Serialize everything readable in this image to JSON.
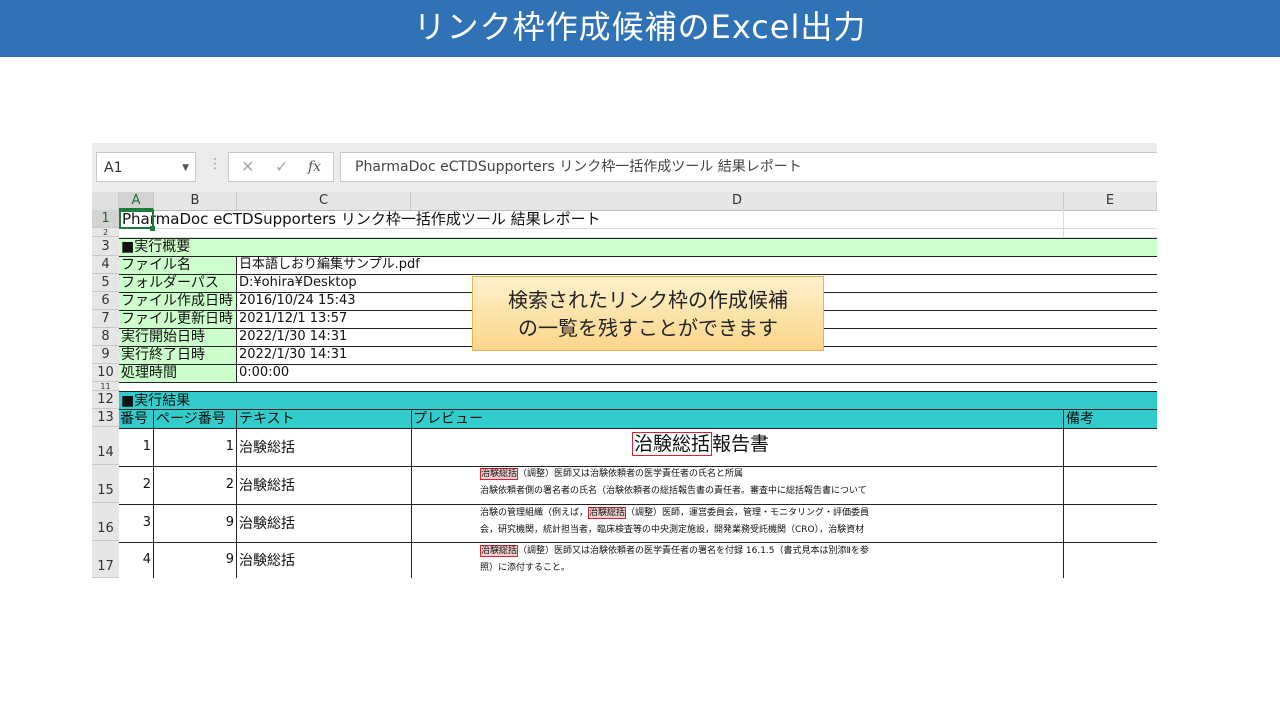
{
  "slide": {
    "title": "リンク枠作成候補のExcel出力"
  },
  "formula_bar": {
    "name_box": "A1",
    "cancel_icon": "✕",
    "enter_icon": "✓",
    "function_icon": "fx",
    "content": "PharmaDoc eCTDSupporters リンク枠一括作成ツール 結果レポート"
  },
  "columns": [
    "A",
    "B",
    "C",
    "D",
    "E"
  ],
  "rows": [
    "1",
    "2",
    "3",
    "4",
    "5",
    "6",
    "7",
    "8",
    "9",
    "10",
    "11",
    "12",
    "13",
    "14",
    "15",
    "16",
    "17"
  ],
  "sheet": {
    "title": "PharmaDoc eCTDSupporters リンク枠一括作成ツール 結果レポート",
    "summary_header": "■実行概要",
    "summary": [
      {
        "label": "ファイル名",
        "value": "日本語しおり編集サンプル.pdf"
      },
      {
        "label": "フォルダーパス",
        "value": "D:¥ohira¥Desktop"
      },
      {
        "label": "ファイル作成日時",
        "value": "2016/10/24 15:43"
      },
      {
        "label": "ファイル更新日時",
        "value": "2021/12/1 13:57"
      },
      {
        "label": "実行開始日時",
        "value": "2022/1/30 14:31"
      },
      {
        "label": "実行終了日時",
        "value": "2022/1/30 14:31"
      },
      {
        "label": "処理時間",
        "value": "0:00:00"
      }
    ],
    "results_header": "■実行結果",
    "results_columns": [
      "番号",
      "ページ番号",
      "テキスト",
      "プレビュー",
      "備考"
    ],
    "results": [
      {
        "no": "1",
        "page": "1",
        "text": "治験総括"
      },
      {
        "no": "2",
        "page": "2",
        "text": "治験総括"
      },
      {
        "no": "3",
        "page": "9",
        "text": "治験総括"
      },
      {
        "no": "4",
        "page": "9",
        "text": "治験総括"
      }
    ]
  },
  "previews": {
    "row1": {
      "highlight": "治験総括",
      "rest": "報告書"
    },
    "row2": {
      "highlight": "治験総括",
      "line1_rest": "（調整）医師又は治験依頼者の医学責任者の氏名と所属",
      "line2": "治験依頼者側の署名者の氏名（治験依頼者の総括報告書の責任者。審査中に総括報告書について"
    },
    "row3": {
      "line1_pre": "治験の管理組織（例えば，",
      "highlight": "治験総括",
      "line1_rest": "（調整）医師，運営委員会，管理・モニタリング・評価委員",
      "line2": "会，研究機関，統計担当者，臨床検査等の中央測定施設，開発業務受託機関（CRO），治験資材"
    },
    "row4": {
      "highlight": "治験総括",
      "line1_rest": "（調整）医師又は治験依頼者の医学責任者の署名を付録 16.1.5（書式見本は別添Ⅱを参",
      "line2": "照）に添付すること。"
    }
  },
  "callout": {
    "line1": "検索されたリンク枠の作成候補",
    "line2": "の一覧を残すことができます"
  },
  "colors": {
    "banner": "#2f72b5",
    "summary_fill": "#ccffcc",
    "results_fill": "#33cccc",
    "highlight_border": "#dd2233"
  }
}
